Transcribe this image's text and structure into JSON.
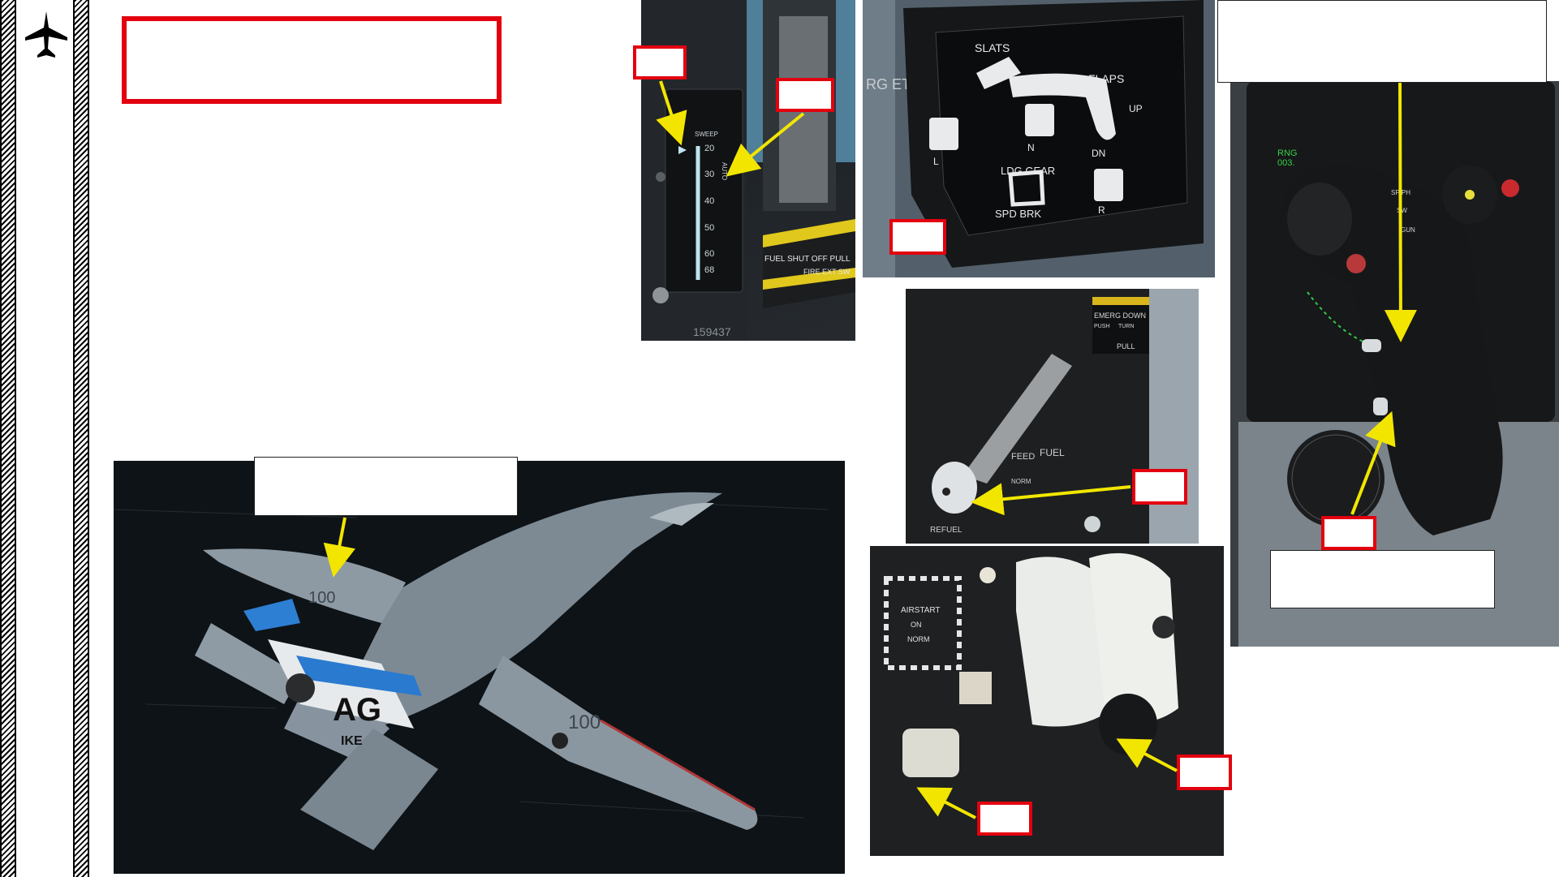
{
  "page": {
    "footer_text": ""
  },
  "wing_sweep_panel": {
    "sweep_label": "SWEEP",
    "scale": [
      "20",
      "30",
      "40",
      "50",
      "60",
      "68"
    ],
    "auto_label": "AUTO",
    "fuel_shutoff_label": "FUEL SHUT OFF PULL",
    "fire_ext_label": "FIRE EXT SW",
    "serial": "159437"
  },
  "slats_flaps_indicator": {
    "slats": "SLATS",
    "flaps": "FLAPS",
    "up": "UP",
    "dn": "DN",
    "n": "N",
    "l": "L",
    "r": "R",
    "ldg_gear": "LDG GEAR",
    "spd_brk": "SPD BRK",
    "side_label": "RG ETT"
  },
  "stick": {
    "rng_label": "RNG",
    "rng_value": "003.",
    "modes": [
      "SP/PH",
      "SW",
      "GUN"
    ]
  },
  "gear_panel": {
    "emerg_down": "EMERG DOWN",
    "push": "PUSH",
    "turn": "TURN",
    "pull": "PULL",
    "feed": "FEED",
    "fuel": "FUEL",
    "refuel": "REFUEL",
    "norm": "NORM"
  },
  "throttle_panel": {
    "airstart": "AIRSTART",
    "on": "ON",
    "norm": "NORM"
  },
  "aircraft": {
    "modex": "100",
    "tail_code": "AG",
    "tail_text": "IKE"
  },
  "colors": {
    "callout_red": "#e3000f",
    "arrow_yellow": "#f2e600"
  }
}
